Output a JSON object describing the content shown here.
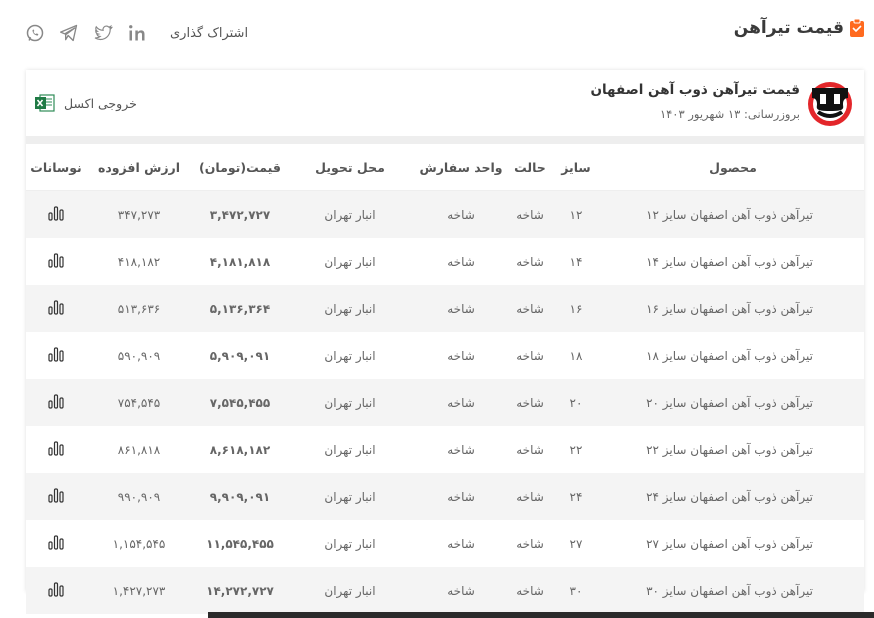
{
  "header": {
    "title": "قیمت تیرآهن",
    "share_label": "اشتراک گذاری",
    "social_icons": [
      "linkedin-icon",
      "twitter-icon",
      "telegram-icon",
      "whatsapp-icon"
    ],
    "accent_color": "#ff6a1f"
  },
  "card": {
    "brand_name": "قیمت تیرآهن ذوب آهن اصفهان",
    "updated_label": "بروزرسانی: ۱۳ شهریور ۱۴۰۳",
    "excel_label": "خروجی اکسل"
  },
  "table": {
    "headers": {
      "product": "محصول",
      "size": "سایز",
      "state": "حالت",
      "unit": "واحد سفارش",
      "delivery": "محل تحویل",
      "price": "قیمت(تومان)",
      "vat": "ارزش افزوده",
      "chart": "نوسانات"
    },
    "rows": [
      {
        "product": "تیرآهن ذوب آهن اصفهان سایز ۱۲",
        "size": "۱۲",
        "state": "شاخه",
        "unit": "شاخه",
        "delivery": "انبار تهران",
        "price": "۳,۴۷۲,۷۲۷",
        "vat": "۳۴۷,۲۷۳"
      },
      {
        "product": "تیرآهن ذوب آهن اصفهان سایز ۱۴",
        "size": "۱۴",
        "state": "شاخه",
        "unit": "شاخه",
        "delivery": "انبار تهران",
        "price": "۴,۱۸۱,۸۱۸",
        "vat": "۴۱۸,۱۸۲"
      },
      {
        "product": "تیرآهن ذوب آهن اصفهان سایز ۱۶",
        "size": "۱۶",
        "state": "شاخه",
        "unit": "شاخه",
        "delivery": "انبار تهران",
        "price": "۵,۱۳۶,۳۶۴",
        "vat": "۵۱۳,۶۳۶"
      },
      {
        "product": "تیرآهن ذوب آهن اصفهان سایز ۱۸",
        "size": "۱۸",
        "state": "شاخه",
        "unit": "شاخه",
        "delivery": "انبار تهران",
        "price": "۵,۹۰۹,۰۹۱",
        "vat": "۵۹۰,۹۰۹"
      },
      {
        "product": "تیرآهن ذوب آهن اصفهان سایز ۲۰",
        "size": "۲۰",
        "state": "شاخه",
        "unit": "شاخه",
        "delivery": "انبار تهران",
        "price": "۷,۵۴۵,۴۵۵",
        "vat": "۷۵۴,۵۴۵"
      },
      {
        "product": "تیرآهن ذوب آهن اصفهان سایز ۲۲",
        "size": "۲۲",
        "state": "شاخه",
        "unit": "شاخه",
        "delivery": "انبار تهران",
        "price": "۸,۶۱۸,۱۸۲",
        "vat": "۸۶۱,۸۱۸"
      },
      {
        "product": "تیرآهن ذوب آهن اصفهان سایز ۲۴",
        "size": "۲۴",
        "state": "شاخه",
        "unit": "شاخه",
        "delivery": "انبار تهران",
        "price": "۹,۹۰۹,۰۹۱",
        "vat": "۹۹۰,۹۰۹"
      },
      {
        "product": "تیرآهن ذوب آهن اصفهان سایز ۲۷",
        "size": "۲۷",
        "state": "شاخه",
        "unit": "شاخه",
        "delivery": "انبار تهران",
        "price": "۱۱,۵۴۵,۴۵۵",
        "vat": "۱,۱۵۴,۵۴۵"
      },
      {
        "product": "تیرآهن ذوب آهن اصفهان سایز ۳۰",
        "size": "۳۰",
        "state": "شاخه",
        "unit": "شاخه",
        "delivery": "انبار تهران",
        "price": "۱۴,۲۷۲,۷۲۷",
        "vat": "۱,۴۲۷,۲۷۳"
      }
    ],
    "vat_color": "#e0493a",
    "row_stripe_color": "#f4f4f4"
  }
}
